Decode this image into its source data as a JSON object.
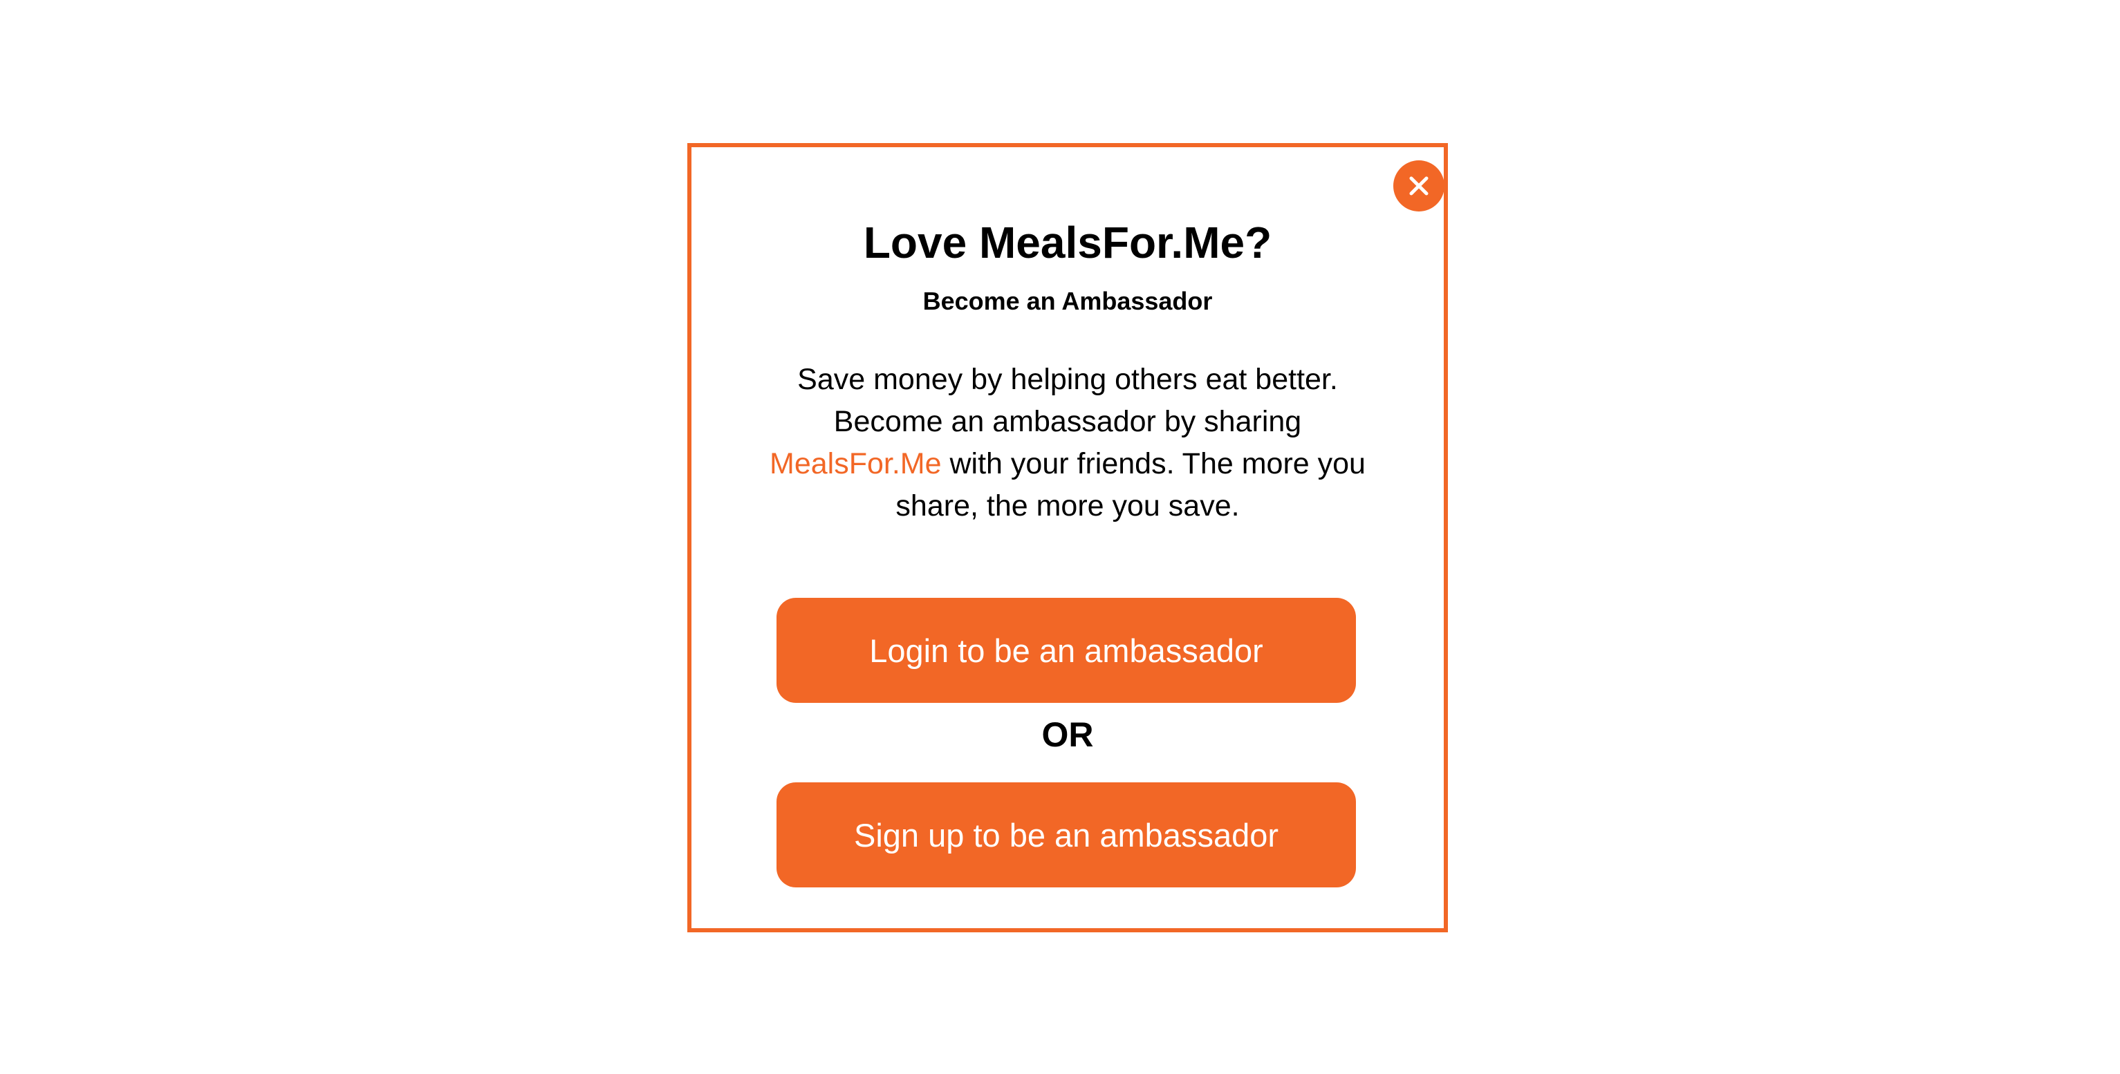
{
  "modal": {
    "title": "Love MealsFor.Me?",
    "subtitle": "Become an Ambassador",
    "body": {
      "line1": "Save money by helping others eat better.",
      "line2": "Become an ambassador by sharing",
      "brand_link": "MealsFor.Me",
      "line3_rest": " with your friends. The more you",
      "line4": "share, the more you save."
    },
    "login_button": "Login to be an ambassador",
    "or_divider": "OR",
    "signup_button": "Sign up to be an ambassador",
    "close_icon": "close-icon"
  },
  "colors": {
    "accent": "#f26726",
    "background": "#ffffff",
    "text": "#000000"
  }
}
